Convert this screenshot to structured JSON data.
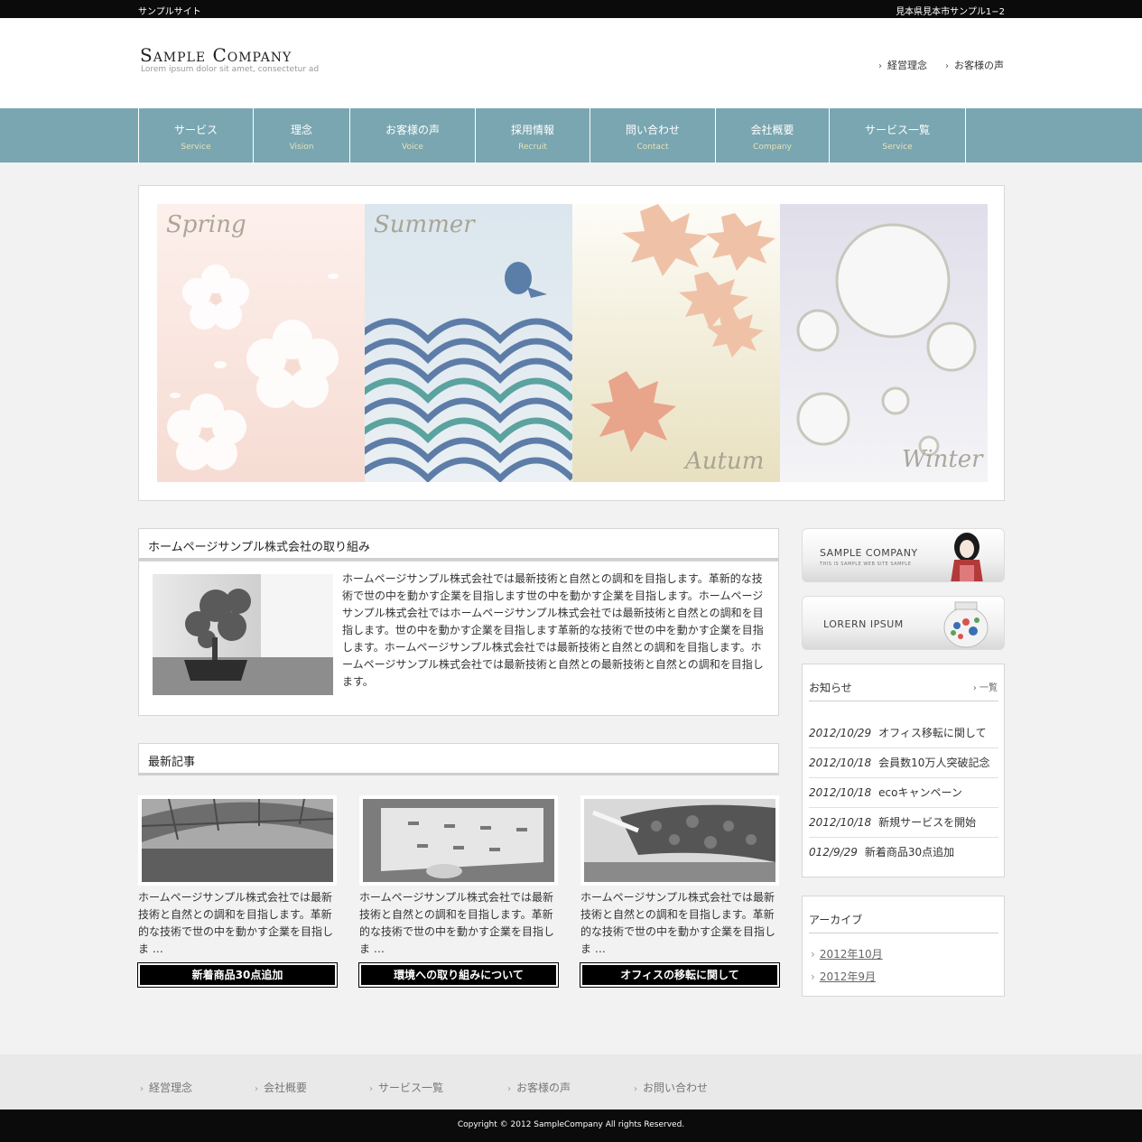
{
  "topbar": {
    "site_name": "サンプルサイト",
    "address": "見本県見本市サンプル1−2"
  },
  "header": {
    "logo_title": "Sample Company",
    "logo_subtitle": "Lorem ipsum dolor sit amet, consectetur ad",
    "links": [
      "経営理念",
      "お客様の声"
    ]
  },
  "nav": [
    {
      "jp": "サービス",
      "en": "Service"
    },
    {
      "jp": "理念",
      "en": "Vision"
    },
    {
      "jp": "お客様の声",
      "en": "Voice"
    },
    {
      "jp": "採用情報",
      "en": "Recruit"
    },
    {
      "jp": "問い合わせ",
      "en": "Contact"
    },
    {
      "jp": "会社概要",
      "en": "Company"
    },
    {
      "jp": "サービス一覧",
      "en": "Service"
    }
  ],
  "hero": {
    "seasons": [
      "Spring",
      "Summer",
      "Autum",
      "Winter"
    ]
  },
  "intro": {
    "title": "ホームページサンプル株式会社の取り組み",
    "text": "ホームページサンプル株式会社では最新技術と自然との調和を目指します。革新的な技術で世の中を動かす企業を目指します世の中を動かす企業を目指します。ホームページサンプル株式会社ではホームページサンプル株式会社では最新技術と自然との調和を目指します。世の中を動かす企業を目指します革新的な技術で世の中を動かす企業を目指します。ホームページサンプル株式会社では最新技術と自然との調和を目指します。ホームページサンプル株式会社では最新技術と自然との最新技術と自然との調和を目指します。"
  },
  "latest": {
    "title": "最新記事",
    "articles": [
      {
        "text": "ホームページサンプル株式会社では最新技術と自然との調和を目指します。革新的な技術で世の中を動かす企業を目指しま …",
        "button": "新着商品30点追加"
      },
      {
        "text": "ホームページサンプル株式会社では最新技術と自然との調和を目指します。革新的な技術で世の中を動かす企業を目指しま …",
        "button": "環境への取り組みについて"
      },
      {
        "text": "ホームページサンプル株式会社では最新技術と自然との調和を目指します。革新的な技術で世の中を動かす企業を目指しま …",
        "button": "オフィスの移転に関して"
      }
    ]
  },
  "sidebar": {
    "banner1": {
      "title": "SAMPLE COMPANY",
      "subtitle": "THIS IS SAMPLE WEB SITE SAMPLE"
    },
    "banner2": {
      "title": "LORERN IPSUM"
    },
    "news": {
      "title": "お知らせ",
      "more": "一覧",
      "items": [
        {
          "date": "2012/10/29",
          "text": "オフィス移転に関して"
        },
        {
          "date": "2012/10/18",
          "text": "会員数10万人突破記念"
        },
        {
          "date": "2012/10/18",
          "text": "ecoキャンペーン"
        },
        {
          "date": "2012/10/18",
          "text": "新規サービスを開始"
        },
        {
          "date": "012/9/29",
          "text": "新着商品30点追加"
        }
      ]
    },
    "archive": {
      "title": "アーカイブ",
      "items": [
        "2012年10月",
        "2012年9月"
      ]
    }
  },
  "footer": {
    "links": [
      "経営理念",
      "会社概要",
      "サービス一覧",
      "お客様の声",
      "お問い合わせ"
    ],
    "copyright": "Copyright © 2012 SampleCompany All rights Reserved."
  }
}
